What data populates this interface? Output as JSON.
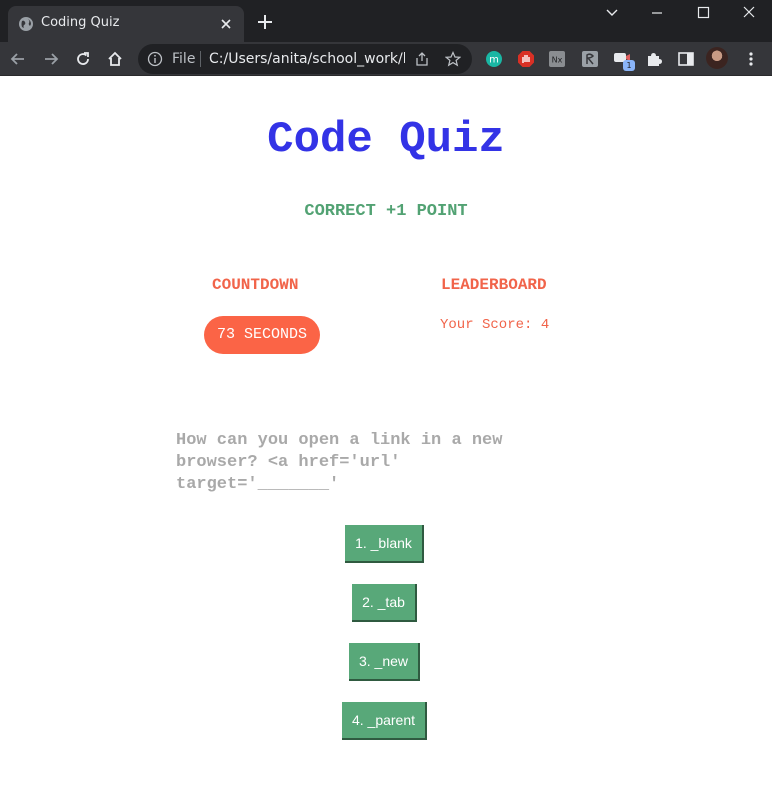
{
  "browser": {
    "tab_title": "Coding Quiz",
    "file_label": "File",
    "url": "C:/Users/anita/school_work/h..."
  },
  "page": {
    "heading": "Code Quiz",
    "feedback": "CORRECT +1 POINT",
    "countdown_title": "COUNTDOWN",
    "timer_text": "73 SECONDS",
    "leaderboard_title": "LEADERBOARD",
    "score_text": "Your Score: 4",
    "question": "How can you open a link in a new browser? <a href='url' target='_______'",
    "answers": [
      "1. _blank",
      "2. _tab",
      "3. _new",
      "4. _parent"
    ]
  },
  "colors": {
    "heading": "#3333e6",
    "feedback": "#52a273",
    "accent": "#fb6446",
    "answer_button": "#58a879",
    "question_text": "#a9a9a9"
  }
}
